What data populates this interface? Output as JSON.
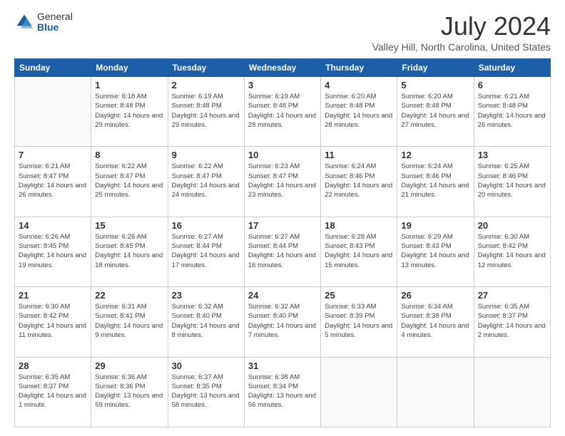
{
  "logo": {
    "general": "General",
    "blue": "Blue"
  },
  "title": "July 2024",
  "subtitle": "Valley Hill, North Carolina, United States",
  "days_header": [
    "Sunday",
    "Monday",
    "Tuesday",
    "Wednesday",
    "Thursday",
    "Friday",
    "Saturday"
  ],
  "weeks": [
    [
      {
        "day": "",
        "sunrise": "",
        "sunset": "",
        "daylight": ""
      },
      {
        "day": "1",
        "sunrise": "Sunrise: 6:18 AM",
        "sunset": "Sunset: 8:48 PM",
        "daylight": "Daylight: 14 hours and 29 minutes."
      },
      {
        "day": "2",
        "sunrise": "Sunrise: 6:19 AM",
        "sunset": "Sunset: 8:48 PM",
        "daylight": "Daylight: 14 hours and 29 minutes."
      },
      {
        "day": "3",
        "sunrise": "Sunrise: 6:19 AM",
        "sunset": "Sunset: 8:48 PM",
        "daylight": "Daylight: 14 hours and 28 minutes."
      },
      {
        "day": "4",
        "sunrise": "Sunrise: 6:20 AM",
        "sunset": "Sunset: 8:48 PM",
        "daylight": "Daylight: 14 hours and 28 minutes."
      },
      {
        "day": "5",
        "sunrise": "Sunrise: 6:20 AM",
        "sunset": "Sunset: 8:48 PM",
        "daylight": "Daylight: 14 hours and 27 minutes."
      },
      {
        "day": "6",
        "sunrise": "Sunrise: 6:21 AM",
        "sunset": "Sunset: 8:48 PM",
        "daylight": "Daylight: 14 hours and 26 minutes."
      }
    ],
    [
      {
        "day": "7",
        "sunrise": "Sunrise: 6:21 AM",
        "sunset": "Sunset: 8:47 PM",
        "daylight": "Daylight: 14 hours and 26 minutes."
      },
      {
        "day": "8",
        "sunrise": "Sunrise: 6:22 AM",
        "sunset": "Sunset: 8:47 PM",
        "daylight": "Daylight: 14 hours and 25 minutes."
      },
      {
        "day": "9",
        "sunrise": "Sunrise: 6:22 AM",
        "sunset": "Sunset: 8:47 PM",
        "daylight": "Daylight: 14 hours and 24 minutes."
      },
      {
        "day": "10",
        "sunrise": "Sunrise: 6:23 AM",
        "sunset": "Sunset: 8:47 PM",
        "daylight": "Daylight: 14 hours and 23 minutes."
      },
      {
        "day": "11",
        "sunrise": "Sunrise: 6:24 AM",
        "sunset": "Sunset: 8:46 PM",
        "daylight": "Daylight: 14 hours and 22 minutes."
      },
      {
        "day": "12",
        "sunrise": "Sunrise: 6:24 AM",
        "sunset": "Sunset: 8:46 PM",
        "daylight": "Daylight: 14 hours and 21 minutes."
      },
      {
        "day": "13",
        "sunrise": "Sunrise: 6:25 AM",
        "sunset": "Sunset: 8:46 PM",
        "daylight": "Daylight: 14 hours and 20 minutes."
      }
    ],
    [
      {
        "day": "14",
        "sunrise": "Sunrise: 6:26 AM",
        "sunset": "Sunset: 8:45 PM",
        "daylight": "Daylight: 14 hours and 19 minutes."
      },
      {
        "day": "15",
        "sunrise": "Sunrise: 6:26 AM",
        "sunset": "Sunset: 8:45 PM",
        "daylight": "Daylight: 14 hours and 18 minutes."
      },
      {
        "day": "16",
        "sunrise": "Sunrise: 6:27 AM",
        "sunset": "Sunset: 8:44 PM",
        "daylight": "Daylight: 14 hours and 17 minutes."
      },
      {
        "day": "17",
        "sunrise": "Sunrise: 6:27 AM",
        "sunset": "Sunset: 8:44 PM",
        "daylight": "Daylight: 14 hours and 16 minutes."
      },
      {
        "day": "18",
        "sunrise": "Sunrise: 6:28 AM",
        "sunset": "Sunset: 8:43 PM",
        "daylight": "Daylight: 14 hours and 15 minutes."
      },
      {
        "day": "19",
        "sunrise": "Sunrise: 6:29 AM",
        "sunset": "Sunset: 8:43 PM",
        "daylight": "Daylight: 14 hours and 13 minutes."
      },
      {
        "day": "20",
        "sunrise": "Sunrise: 6:30 AM",
        "sunset": "Sunset: 8:42 PM",
        "daylight": "Daylight: 14 hours and 12 minutes."
      }
    ],
    [
      {
        "day": "21",
        "sunrise": "Sunrise: 6:30 AM",
        "sunset": "Sunset: 8:42 PM",
        "daylight": "Daylight: 14 hours and 11 minutes."
      },
      {
        "day": "22",
        "sunrise": "Sunrise: 6:31 AM",
        "sunset": "Sunset: 8:41 PM",
        "daylight": "Daylight: 14 hours and 9 minutes."
      },
      {
        "day": "23",
        "sunrise": "Sunrise: 6:32 AM",
        "sunset": "Sunset: 8:40 PM",
        "daylight": "Daylight: 14 hours and 8 minutes."
      },
      {
        "day": "24",
        "sunrise": "Sunrise: 6:32 AM",
        "sunset": "Sunset: 8:40 PM",
        "daylight": "Daylight: 14 hours and 7 minutes."
      },
      {
        "day": "25",
        "sunrise": "Sunrise: 6:33 AM",
        "sunset": "Sunset: 8:39 PM",
        "daylight": "Daylight: 14 hours and 5 minutes."
      },
      {
        "day": "26",
        "sunrise": "Sunrise: 6:34 AM",
        "sunset": "Sunset: 8:38 PM",
        "daylight": "Daylight: 14 hours and 4 minutes."
      },
      {
        "day": "27",
        "sunrise": "Sunrise: 6:35 AM",
        "sunset": "Sunset: 8:37 PM",
        "daylight": "Daylight: 14 hours and 2 minutes."
      }
    ],
    [
      {
        "day": "28",
        "sunrise": "Sunrise: 6:35 AM",
        "sunset": "Sunset: 8:37 PM",
        "daylight": "Daylight: 14 hours and 1 minute."
      },
      {
        "day": "29",
        "sunrise": "Sunrise: 6:36 AM",
        "sunset": "Sunset: 8:36 PM",
        "daylight": "Daylight: 13 hours and 59 minutes."
      },
      {
        "day": "30",
        "sunrise": "Sunrise: 6:37 AM",
        "sunset": "Sunset: 8:35 PM",
        "daylight": "Daylight: 13 hours and 58 minutes."
      },
      {
        "day": "31",
        "sunrise": "Sunrise: 6:38 AM",
        "sunset": "Sunset: 8:34 PM",
        "daylight": "Daylight: 13 hours and 56 minutes."
      },
      {
        "day": "",
        "sunrise": "",
        "sunset": "",
        "daylight": ""
      },
      {
        "day": "",
        "sunrise": "",
        "sunset": "",
        "daylight": ""
      },
      {
        "day": "",
        "sunrise": "",
        "sunset": "",
        "daylight": ""
      }
    ]
  ]
}
